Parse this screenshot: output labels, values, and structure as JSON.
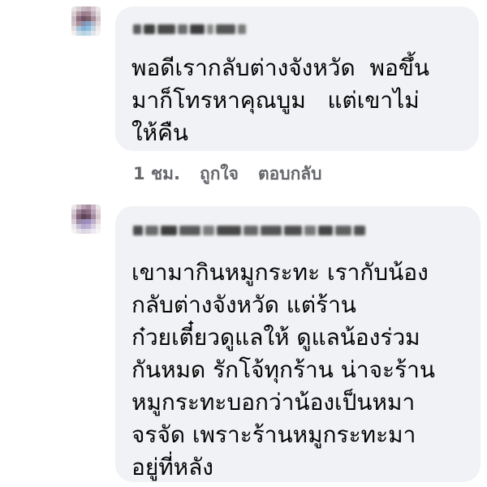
{
  "comments": [
    {
      "author": "",
      "text": "พอดีเรากลับต่างจังหวัด  พอขึ้น\nมาก็โทรหาคุณบูม   แต่เขาไม่\nให้คืน",
      "time": "1 ชม.",
      "like_label": "ถูกใจ",
      "reply_label": "ตอบกลับ"
    },
    {
      "author": "",
      "text": "เขามากินหมูกระทะ เรากับน้อง\nกลับต่างจังหวัด แต่ร้าน\nก๋วยเตี๋ยวดูแลให้ ดูแลน้องร่วม\nกันหมด รักโจ้ทุกร้าน น่าจะร้าน\nหมูกระทะบอกว่าน้องเป็นหมา\nจรจัด เพราะร้านหมูกระทะมา\nอยู่ที่หลัง"
    }
  ],
  "colors": {
    "bubble": "#f0f2f5",
    "text": "#050505",
    "meta": "#65676b"
  }
}
